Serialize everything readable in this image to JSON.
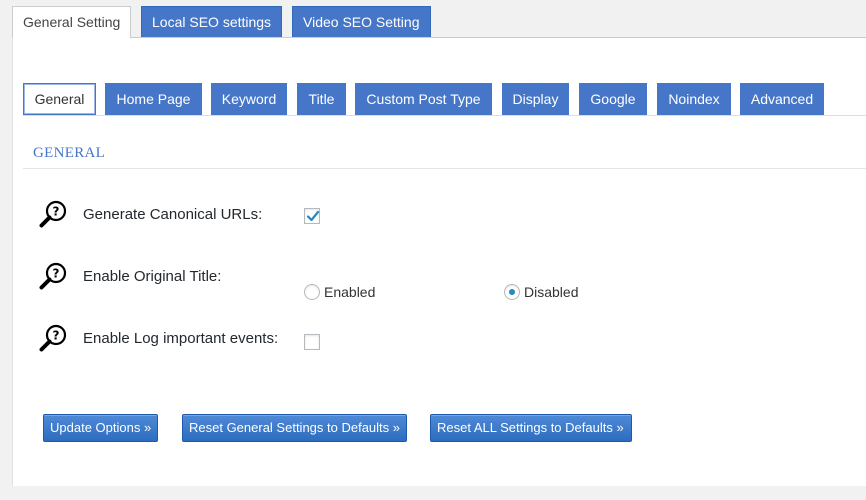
{
  "top_tabs": [
    {
      "label": "General Setting",
      "active": true
    },
    {
      "label": "Local SEO settings",
      "active": false
    },
    {
      "label": "Video SEO Setting",
      "active": false
    }
  ],
  "sub_tabs": [
    {
      "label": "General",
      "active": true
    },
    {
      "label": "Home Page",
      "active": false
    },
    {
      "label": "Keyword",
      "active": false
    },
    {
      "label": "Title",
      "active": false
    },
    {
      "label": "Custom Post Type",
      "active": false
    },
    {
      "label": "Display",
      "active": false
    },
    {
      "label": "Google",
      "active": false
    },
    {
      "label": "Noindex",
      "active": false
    },
    {
      "label": "Advanced",
      "active": false
    }
  ],
  "section": {
    "title": "GENERAL"
  },
  "settings": {
    "canonical": {
      "label": "Generate Canonical URLs:",
      "checked": true
    },
    "original_title": {
      "label": "Enable Original Title:",
      "options": [
        {
          "label": "Enabled",
          "selected": false
        },
        {
          "label": "Disabled",
          "selected": true
        }
      ]
    },
    "log_events": {
      "label": "Enable Log important events:",
      "checked": false
    }
  },
  "buttons": {
    "update": "Update Options »",
    "reset_general": "Reset General Settings to Defaults »",
    "reset_all": "Reset ALL Settings to Defaults »"
  },
  "colors": {
    "accent": "#4676c8",
    "radio_dot": "#1e8cbe",
    "checkmark": "#1e8cbe"
  },
  "icons": {
    "help": "help-magnifier-question-icon"
  }
}
